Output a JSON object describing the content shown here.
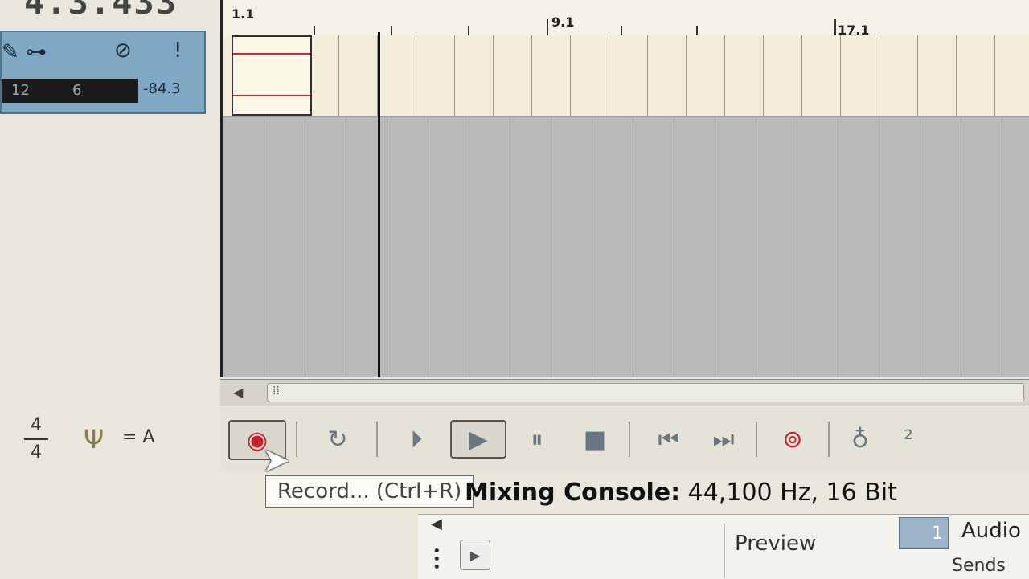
{
  "time_display": "4.3.433",
  "track": {
    "meter_marks": [
      "12",
      "6"
    ],
    "level": "-84.3"
  },
  "ruler": {
    "markers": [
      "1.1",
      "9.1",
      "17.1"
    ]
  },
  "transport": {
    "time_signature_top": "4",
    "time_signature_bottom": "4",
    "tuner_label": "= A",
    "icons": [
      "record-icon",
      "loop-icon",
      "play-from-start-icon",
      "play-icon",
      "pause-icon",
      "stop-icon",
      "go-to-start-icon",
      "go-to-end-icon",
      "record-arm-icon",
      "metronome-icon",
      "count-in-icon"
    ]
  },
  "tooltip": "Record... (Ctrl+R)",
  "mixing_console": {
    "title_bold": "Mixing Console:",
    "title_info": "44,100 Hz, 16 Bit",
    "preview_label": "Preview",
    "channel_number": "1",
    "audio_label": "Audio",
    "sends_label": "Sends"
  }
}
